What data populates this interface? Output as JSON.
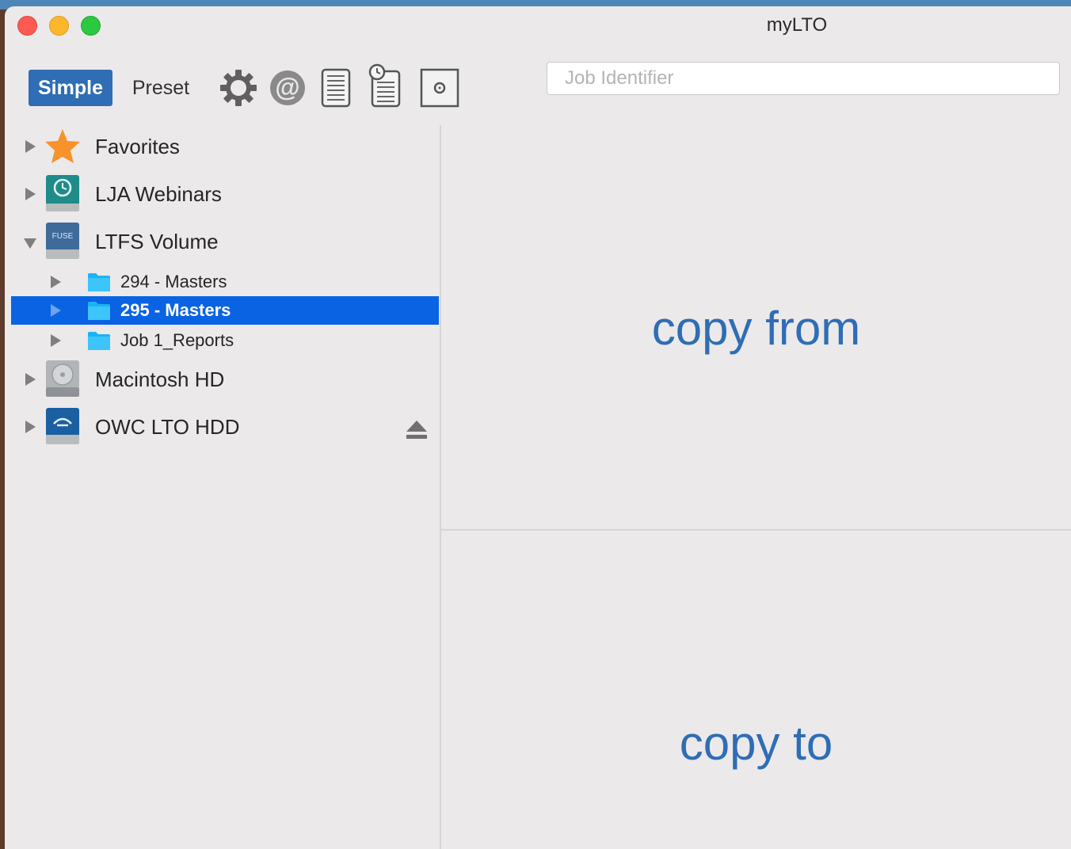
{
  "window": {
    "title": "myLTO"
  },
  "toolbar": {
    "simple_label": "Simple",
    "preset_label": "Preset",
    "icons": [
      "gear-icon",
      "at-icon",
      "document-list-icon",
      "scheduled-document-icon",
      "disk-icon"
    ],
    "job_identifier_placeholder": "Job Identifier",
    "job_identifier_value": ""
  },
  "sidebar": {
    "items": [
      {
        "label": "Favorites",
        "icon": "star-icon",
        "expanded": false
      },
      {
        "label": "LJA Webinars",
        "icon": "time-machine-drive-icon",
        "expanded": false
      },
      {
        "label": "LTFS Volume",
        "icon": "fuse-drive-icon",
        "expanded": true,
        "children": [
          {
            "label": "294 - Masters",
            "icon": "folder-icon",
            "selected": false
          },
          {
            "label": "295 - Masters",
            "icon": "folder-icon",
            "selected": true
          },
          {
            "label": "Job 1_Reports",
            "icon": "folder-icon",
            "selected": false
          }
        ]
      },
      {
        "label": "Macintosh HD",
        "icon": "internal-drive-icon",
        "expanded": false
      },
      {
        "label": "OWC LTO HDD",
        "icon": "external-drive-icon",
        "expanded": false,
        "ejectable": true
      }
    ]
  },
  "main": {
    "copy_from_label": "copy from",
    "copy_to_label": "copy to"
  },
  "colors": {
    "accent": "#2f6db4",
    "selection": "#0a63e3",
    "folder": "#19b4f4",
    "star": "#f7932a"
  }
}
